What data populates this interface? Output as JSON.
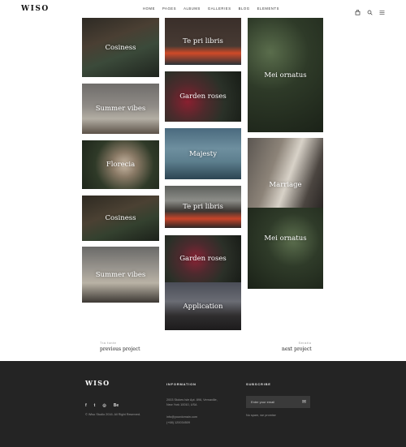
{
  "header": {
    "logo": "WISO",
    "nav": [
      "HOME",
      "PAGES",
      "ALBUMS",
      "GALLERIES",
      "BLOG",
      "ELEMENTS"
    ],
    "icons": [
      "cart-icon",
      "search-icon",
      "menu-icon"
    ]
  },
  "gallery": {
    "items": [
      {
        "title": "Cosiness"
      },
      {
        "title": "Summer vibes"
      },
      {
        "title": "Florecia"
      },
      {
        "title": "Cosiness"
      },
      {
        "title": "Summer vibes"
      },
      {
        "title": "Te pri libris"
      },
      {
        "title": "Garden roses"
      },
      {
        "title": "Majesty"
      },
      {
        "title": "Te pri libris"
      },
      {
        "title": "Garden roses"
      },
      {
        "title": "Application"
      },
      {
        "title": "Mei ornatus"
      },
      {
        "title": "Marriage"
      },
      {
        "title": "Mei ornatus"
      }
    ]
  },
  "pagination": {
    "prev_small": "Tra fonte",
    "prev_label": "previous project",
    "next_small": "Seratio",
    "next_label": "next project"
  },
  "footer": {
    "logo": "WISO",
    "social": [
      "f",
      "t",
      "◎",
      "Be"
    ],
    "copyright": "© Wiso Studio 2016. All Right Reserved.",
    "info_heading": "INFORMATION",
    "address_line1": "2003 Stokes Isle Apt. 896, Vernaville,",
    "address_line2": "New York 10010, USA",
    "email": "info@yourdomain.com",
    "phone": "(+68) 120034509",
    "subscribe_heading": "SUBSCRIBE",
    "subscribe_placeholder": "Enter your email",
    "subscribe_note": "No spam, we promise"
  },
  "colors": {
    "footer_bg": "#242424",
    "accent": "#ffffff"
  }
}
